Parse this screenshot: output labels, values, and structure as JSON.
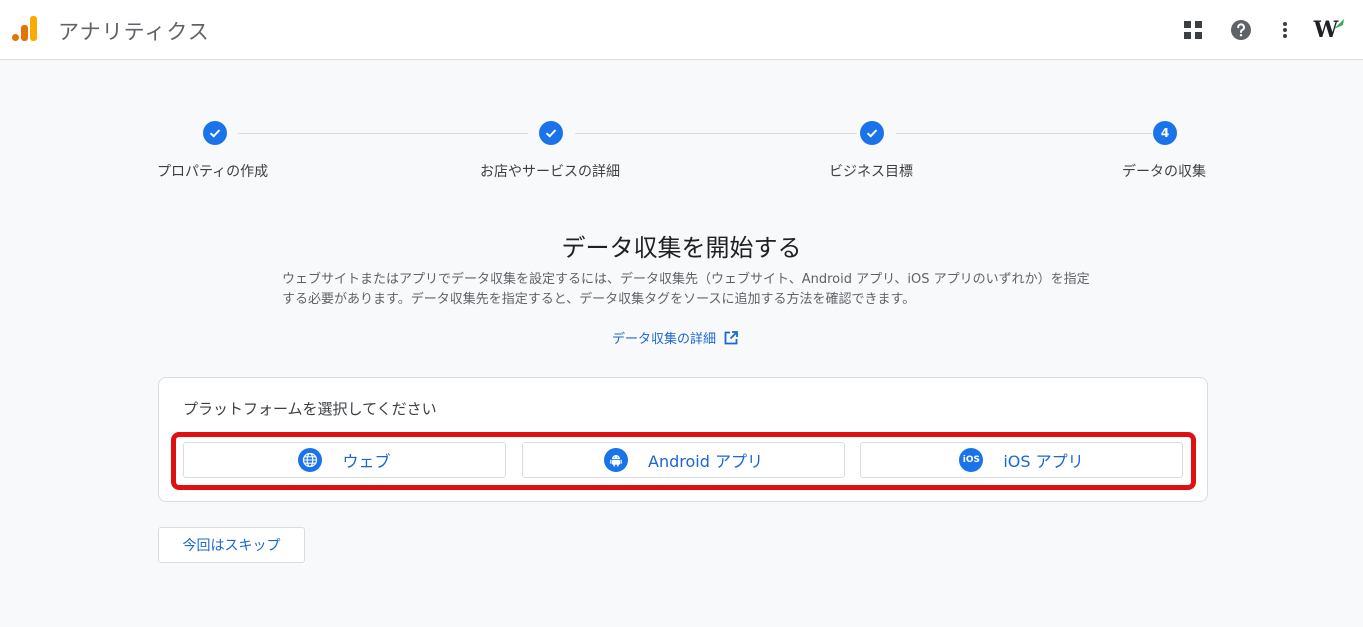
{
  "header": {
    "app_title": "アナリティクス",
    "icons": [
      "analytics-logo",
      "apps-grid-icon",
      "help-icon",
      "more-vert-icon",
      "account-avatar"
    ],
    "avatar_text": "W"
  },
  "stepper": {
    "steps": [
      {
        "label": "プロパティの作成",
        "status": "done",
        "marker": "✓"
      },
      {
        "label": "お店やサービスの詳細",
        "status": "done",
        "marker": "✓"
      },
      {
        "label": "ビジネス目標",
        "status": "done",
        "marker": "✓"
      },
      {
        "label": "データの収集",
        "status": "current",
        "marker": "4"
      }
    ]
  },
  "main": {
    "heading": "データ収集を開始する",
    "description": "ウェブサイトまたはアプリでデータ収集を設定するには、データ収集先（ウェブサイト、Android アプリ、iOS アプリのいずれか）を指定する必要があります。データ収集先を指定すると、データ収集タグをソースに追加する方法を確認できます。",
    "learn_more": "データ収集の詳細"
  },
  "platform_card": {
    "title": "プラットフォームを選択してください",
    "buttons": [
      {
        "label": "ウェブ",
        "icon": "globe-icon"
      },
      {
        "label": "Android アプリ",
        "icon": "android-icon"
      },
      {
        "label": "iOS アプリ",
        "icon": "ios-icon",
        "icon_text": "iOS"
      }
    ]
  },
  "skip_label": "今回はスキップ",
  "colors": {
    "accent": "#1a73e8",
    "link": "#1967d2",
    "highlight": "#e01010",
    "logo_orange": "#e37400",
    "logo_yellow": "#f9ab00"
  }
}
